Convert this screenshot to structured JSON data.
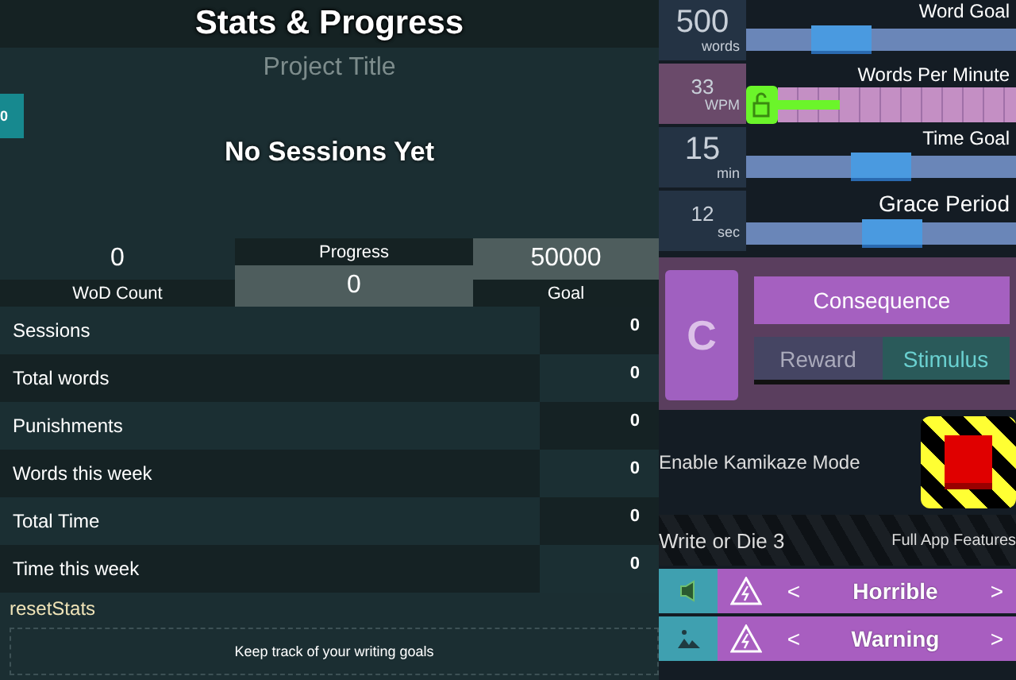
{
  "title": "Stats & Progress",
  "project_title": "Project Title",
  "side_tab": "0",
  "empty_message": "No Sessions Yet",
  "summary": {
    "wod_count": {
      "value": "0",
      "label": "WoD Count"
    },
    "progress": {
      "label": "Progress",
      "value": "0"
    },
    "goal": {
      "value": "50000",
      "label": "Goal"
    }
  },
  "stats": [
    {
      "label": "Sessions",
      "value": "0"
    },
    {
      "label": "Total words",
      "value": "0"
    },
    {
      "label": "Punishments",
      "value": "0"
    },
    {
      "label": "Words this week",
      "value": "0"
    },
    {
      "label": "Total Time",
      "value": "0"
    },
    {
      "label": "Time this week",
      "value": "0"
    }
  ],
  "reset_link": "resetStats",
  "footer_note": "Keep track of your writing goals",
  "settings": [
    {
      "kind": "slider",
      "label": "Word Goal",
      "value": "500",
      "unit": "words",
      "level": 0.35
    },
    {
      "kind": "lock",
      "label": "Words Per Minute",
      "value": "33",
      "unit": "WPM",
      "level": 0.26
    },
    {
      "kind": "slider",
      "label": "Time Goal",
      "value": "15",
      "unit": "min",
      "level": 0.5
    },
    {
      "kind": "slider",
      "label": "Grace Period",
      "value": "12",
      "unit": "sec",
      "level": 0.54
    }
  ],
  "mode": {
    "letter": "C",
    "button": "Consequence",
    "tabs": [
      {
        "label": "Reward",
        "selected": false
      },
      {
        "label": "Stimulus",
        "selected": true
      }
    ]
  },
  "kamikaze": {
    "label": "Enable Kamikaze Mode",
    "on": false
  },
  "brand": "Write or Die 3",
  "features_link": "Full App Features",
  "selectors": [
    {
      "kind": "sound",
      "value": "Horrible",
      "prev": "<",
      "next": ">"
    },
    {
      "kind": "image",
      "value": "Warning",
      "prev": "<",
      "next": ">"
    }
  ]
}
